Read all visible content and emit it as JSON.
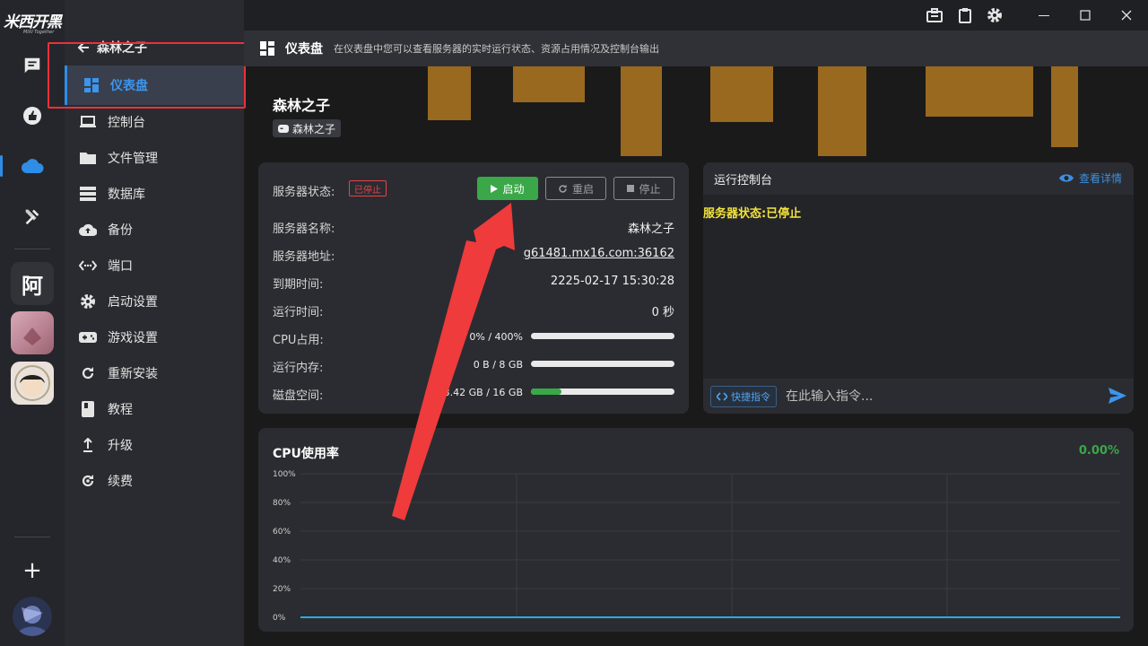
{
  "app": {
    "brand": "米西开黑",
    "brand_sub": "MIXI Together"
  },
  "rail": {
    "items": [
      {
        "name": "messages",
        "icon": "chat-icon"
      },
      {
        "name": "likes",
        "icon": "thumbs-up-icon"
      },
      {
        "name": "cloud",
        "icon": "cloud-icon",
        "active": true
      },
      {
        "name": "tools",
        "icon": "tools-icon"
      }
    ],
    "tile_text": "阿",
    "add_label": "+"
  },
  "sidebar": {
    "back_label": "森林之子",
    "active_item": "仪表盘",
    "items": [
      {
        "label": "控制台",
        "icon": "laptop-icon"
      },
      {
        "label": "文件管理",
        "icon": "folder-icon"
      },
      {
        "label": "数据库",
        "icon": "database-icon"
      },
      {
        "label": "备份",
        "icon": "cloud-upload-icon"
      },
      {
        "label": "端口",
        "icon": "port-icon"
      },
      {
        "label": "启动设置",
        "icon": "gear-icon"
      },
      {
        "label": "游戏设置",
        "icon": "gamepad-icon"
      },
      {
        "label": "重新安装",
        "icon": "reload-icon"
      },
      {
        "label": "教程",
        "icon": "book-icon"
      },
      {
        "label": "升级",
        "icon": "upgrade-icon"
      },
      {
        "label": "续费",
        "icon": "renew-icon"
      }
    ]
  },
  "header": {
    "title": "仪表盘",
    "description": "在仪表盘中您可以查看服务器的实时运行状态、资源占用情况及控制台输出"
  },
  "server": {
    "title": "森林之子",
    "tag": "森林之子"
  },
  "status": {
    "label": "服务器状态:",
    "badge": "已停止",
    "buttons": {
      "start": "启动",
      "restart": "重启",
      "stop": "停止"
    },
    "rows": {
      "name_label": "服务器名称:",
      "name_value": "森林之子",
      "address_label": "服务器地址:",
      "address_value": "g61481.mx16.com:36162",
      "expire_label": "到期时间:",
      "expire_value": "2225-02-17 15:30:28",
      "uptime_label": "运行时间:",
      "uptime_value": "0 秒",
      "cpu_label": "CPU占用:",
      "cpu_value": "0% / 400%",
      "cpu_fraction": 0,
      "mem_label": "运行内存:",
      "mem_value": "0 B / 8 GB",
      "mem_fraction": 0,
      "disk_label": "磁盘空间:",
      "disk_value": "3.42 GB / 16 GB",
      "disk_fraction": 0.214
    }
  },
  "console": {
    "title": "运行控制台",
    "detail": "查看详情",
    "output": "服务器状态:已停止",
    "quick_label": "快捷指令",
    "input_placeholder": "在此输入指令..."
  },
  "cpu_chart": {
    "title": "CPU使用率",
    "current": "0.00%"
  },
  "chart_data": {
    "type": "line",
    "title": "CPU使用率",
    "yticks": [
      "100%",
      "80%",
      "60%",
      "40%",
      "20%",
      "0%"
    ],
    "ylim": [
      0,
      100
    ],
    "series": [
      {
        "values": [
          0,
          0,
          0,
          0,
          0,
          0,
          0,
          0,
          0,
          0
        ]
      }
    ],
    "grid": true,
    "colors": {
      "line": "#2ea8e6"
    }
  },
  "colors": {
    "accent": "#2e8de6",
    "success": "#3aa748",
    "danger": "#e0454b",
    "console_text": "#f2e33a"
  }
}
